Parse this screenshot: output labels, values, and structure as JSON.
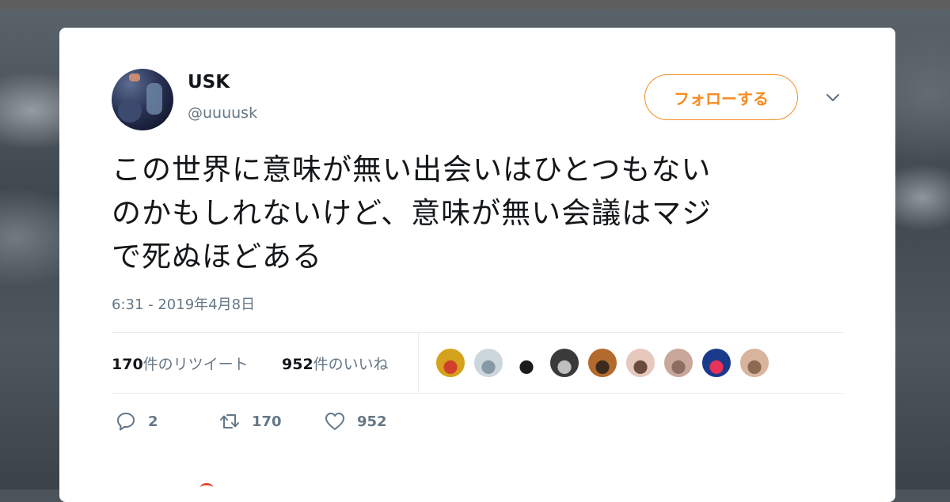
{
  "tweet": {
    "display_name": "USK",
    "handle": "@uuuusk",
    "follow_label": "フォローする",
    "text_lines": [
      "この世界に意味が無い出会いはひとつもない",
      "のかもしれないけど、意味が無い会議はマジ",
      "で死ぬほどある"
    ],
    "timestamp": "6:31 - 2019年4月8日",
    "retweets": {
      "count": "170",
      "label": "件のリツイート"
    },
    "likes": {
      "count": "952",
      "label": "件のいいね"
    },
    "actions": {
      "reply_count": "2",
      "retweet_count": "170",
      "like_count": "952"
    },
    "accent_color": "#f68c21"
  },
  "likers": [
    {
      "name": "liker-1-avatar",
      "color": "#d4a21b",
      "detail": "#d1402a"
    },
    {
      "name": "liker-2-avatar",
      "color": "#ccd6dd",
      "detail": "#8899a6"
    },
    {
      "name": "liker-3-avatar",
      "color": "#ffffff",
      "detail": "#1b1b1b"
    },
    {
      "name": "liker-4-avatar",
      "color": "#3a3a3a",
      "detail": "#bfbfbf"
    },
    {
      "name": "liker-5-avatar",
      "color": "#b36a2d",
      "detail": "#3c2a1e"
    },
    {
      "name": "liker-6-avatar",
      "color": "#e6c8bd",
      "detail": "#6b4b3e"
    },
    {
      "name": "liker-7-avatar",
      "color": "#c9a79a",
      "detail": "#8c6d62"
    },
    {
      "name": "liker-8-avatar",
      "color": "#1a3a8c",
      "detail": "#e8325a"
    },
    {
      "name": "liker-9-avatar",
      "color": "#d8b49e",
      "detail": "#8c6a52"
    }
  ]
}
